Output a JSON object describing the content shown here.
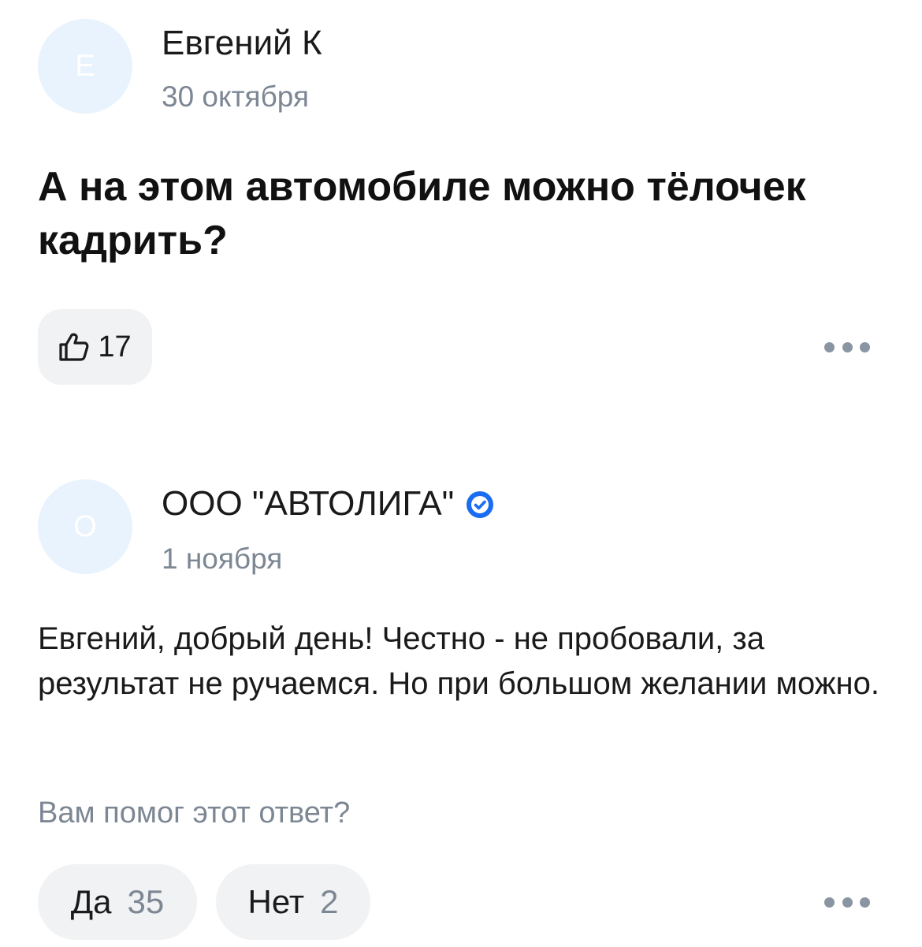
{
  "review": {
    "avatar_letter": "Е",
    "author": "Евгений К",
    "date": "30 октября",
    "text": "А на этом автомобиле можно тёлочек кадрить?",
    "likes": "17",
    "like_icon": "thumbs-up-icon",
    "more_icon": "more-horizontal-icon"
  },
  "reply": {
    "avatar_letter": "О",
    "author": "ООО \"АВТОЛИГА\"",
    "verified_icon": "verified-check-icon",
    "date": "1 ноября",
    "text": "Евгений, добрый день! Честно - не пробовали, за результат не ручаемся. Но при большом желании можно.",
    "helpful_question": "Вам помог этот ответ?",
    "yes_label": "Да",
    "yes_count": "35",
    "no_label": "Нет",
    "no_count": "2",
    "more_icon": "more-horizontal-icon"
  },
  "colors": {
    "avatar_bg": "#e9f3fd",
    "button_bg": "#f1f2f4",
    "secondary_text": "#7d8794",
    "verified_blue": "#1a6cf0"
  }
}
